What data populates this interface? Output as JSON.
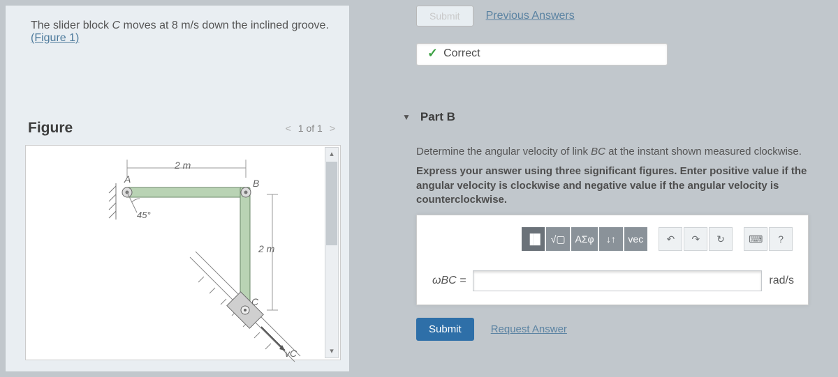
{
  "problem": {
    "prefix": "The slider block ",
    "var": "C",
    "mid": " moves at 8 m/s down the inclined groove. ",
    "figure_link": "(Figure 1)"
  },
  "figure": {
    "title": "Figure",
    "pager_prev": "<",
    "pager_label": "1 of 1",
    "pager_next": ">",
    "labels": {
      "A": "A",
      "B": "B",
      "C": "C",
      "vc": "vC",
      "angle": "45°",
      "dim_h": "2 m",
      "dim_v": "2 m"
    }
  },
  "top": {
    "ghost_btn": "Submit",
    "prev_answers": "Previous Answers",
    "correct": "Correct"
  },
  "part": {
    "caret": "▼",
    "title": "Part B",
    "q1": "Determine the angular velocity of link ",
    "q1_var": "BC",
    "q1_tail": " at the instant shown measured clockwise.",
    "instr": "Express your answer using three significant figures. Enter positive value if the angular velocity is clockwise and negative value if the angular velocity is counterclockwise."
  },
  "toolbar": {
    "btns": {
      "templates": "▐█",
      "sqrt": "√▢",
      "greek": "ΑΣφ",
      "scripts": "↓↑",
      "vec": "vec",
      "undo": "↶",
      "redo": "↷",
      "reset": "↻",
      "keyboard": "⌨",
      "help": "?"
    }
  },
  "answer": {
    "lhs": "ωBC =",
    "units": "rad/s"
  },
  "actions": {
    "submit": "Submit",
    "request": "Request Answer"
  }
}
